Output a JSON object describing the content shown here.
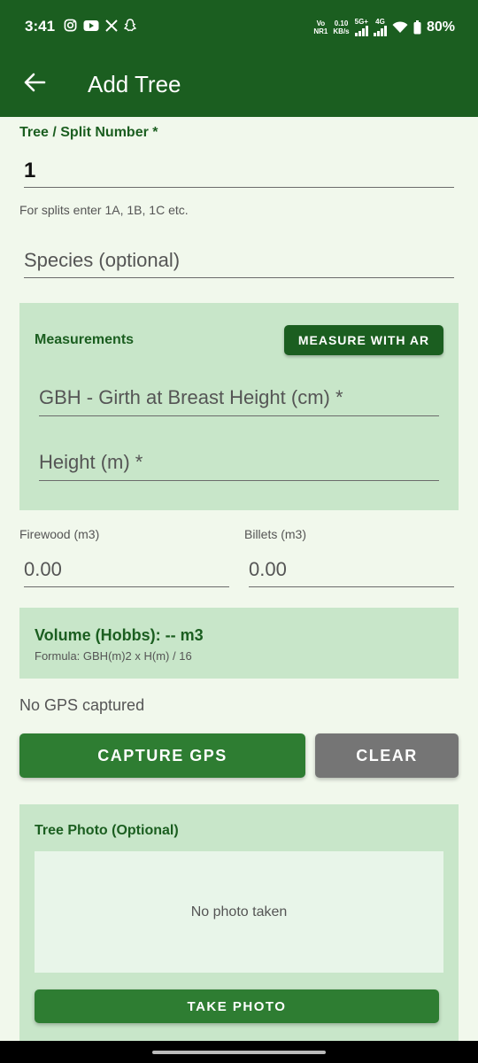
{
  "status_bar": {
    "time": "3:41",
    "network_top": "Vo",
    "network_bottom": "NR1",
    "speed_top": "0.10",
    "speed_bottom": "KB/s",
    "net_5g": "5G+",
    "net_4g": "4G",
    "battery": "80%",
    "app_icons": [
      "instagram-icon",
      "youtube-icon",
      "x-icon",
      "snapchat-icon"
    ]
  },
  "app_bar": {
    "title": "Add Tree"
  },
  "tree_field": {
    "label": "Tree / Split Number *",
    "value": "1",
    "helper": "For splits enter 1A, 1B, 1C etc."
  },
  "species_field": {
    "placeholder": "Species (optional)"
  },
  "measurements": {
    "title": "Measurements",
    "ar_button": "MEASURE WITH AR",
    "gbh_placeholder": "GBH - Girth at Breast Height (cm) *",
    "height_placeholder": "Height (m) *"
  },
  "firewood": {
    "label": "Firewood (m3)",
    "value": "0.00"
  },
  "billets": {
    "label": "Billets (m3)",
    "value": "0.00"
  },
  "volume": {
    "title": "Volume (Hobbs): -- m3",
    "formula": "Formula: GBH(m)2 x H(m) / 16"
  },
  "gps": {
    "status": "No GPS captured",
    "capture_button": "CAPTURE GPS",
    "clear_button": "CLEAR"
  },
  "photo": {
    "title": "Tree Photo (Optional)",
    "placeholder": "No photo taken",
    "take_button": "TAKE PHOTO"
  },
  "colors": {
    "primary_dark": "#1b5e20",
    "primary": "#2e7d32",
    "card": "#c8e6c9",
    "background": "#f1f8ec",
    "clear_button": "#757575"
  }
}
